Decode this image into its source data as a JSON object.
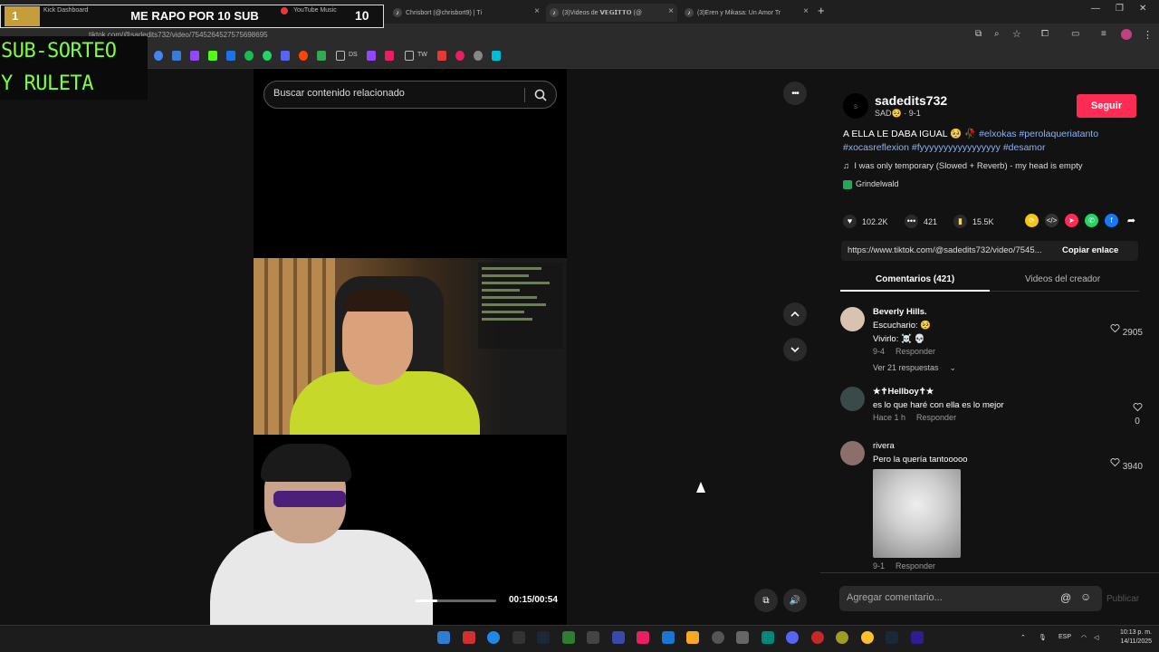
{
  "browser": {
    "tabs": [
      {
        "label": "Kick Dashboard"
      },
      {
        "label": "YouTube Music"
      },
      {
        "label": "Chrisbort (@chrisbort9) | Ti"
      },
      {
        "label": "(3)Videos de 𝗩𝗘𝗚𝗜𝗧𝗧𝗢 (@"
      },
      {
        "label": "(3)Eren y Mikasa: Un Amor Tr"
      }
    ],
    "new_tab": "+",
    "url": "tiktok.com/@sadedits732/video/7545264527575698695",
    "bookmarks": [
      {
        "label": "DS"
      },
      {
        "label": "TW"
      }
    ]
  },
  "overlay": {
    "badge_number": "1",
    "title": "ME RAPO POR 10 SUB",
    "count": "10",
    "sorteo_line1": "SUB-SORTEO",
    "sorteo_line2": "Y RULETA"
  },
  "search": {
    "placeholder": "Buscar contenido relacionado"
  },
  "player": {
    "time": "00:15/00:54",
    "progress": 0.28,
    "more": "•••"
  },
  "post": {
    "avatar_letter": "s",
    "username": "sadedits732",
    "subline": "SAD🥺 · 9-1",
    "follow_label": "Seguir",
    "desc_text": "A ELLA LE DABA IGUAL 🥺 🥀",
    "desc_tags": [
      "#elxokas",
      "#perolaqueriatanto",
      "#xocasreflexion",
      "#fyyyyyyyyyyyyyyyyy",
      "#desamor"
    ],
    "music": "I was only temporary (Slowed + Reverb) - my head is empty",
    "effect": "Grindelwald",
    "likes": "102.2K",
    "comments": "421",
    "saves": "15.5K",
    "share_url": "https://www.tiktok.com/@sadedits732/video/7545...",
    "copy_label": "Copiar enlace"
  },
  "tabs": {
    "comments": "Comentarios (421)",
    "creator_videos": "Videos del creador"
  },
  "comments": [
    {
      "name": "Beverly Hills.",
      "lines": [
        "Escuchario: 🥺",
        "Vivirlo: ☠️ 💀"
      ],
      "date": "9-4",
      "reply": "Responder",
      "likes": "2905",
      "replies": "Ver 21 respuestas"
    },
    {
      "name": "★✝Hellboy✝★",
      "lines": [
        "es lo que haré con ella es lo mejor"
      ],
      "date": "Hace 1 h",
      "reply": "Responder",
      "likes": "0"
    },
    {
      "name": "rivera",
      "lines": [
        "Pero la quería tantooooo"
      ],
      "date": "9-1",
      "reply": "Responder",
      "likes": "3940"
    }
  ],
  "comment_input": {
    "placeholder": "Agregar comentario...",
    "publish": "Publicar"
  },
  "taskbar": {
    "lang": "ESP",
    "time": "10:13 p. m.",
    "date": "14/11/2025"
  },
  "colors": {
    "accent": "#fe2c55",
    "tag": "#8ab4f8",
    "sorteo": "#7dff3e"
  }
}
